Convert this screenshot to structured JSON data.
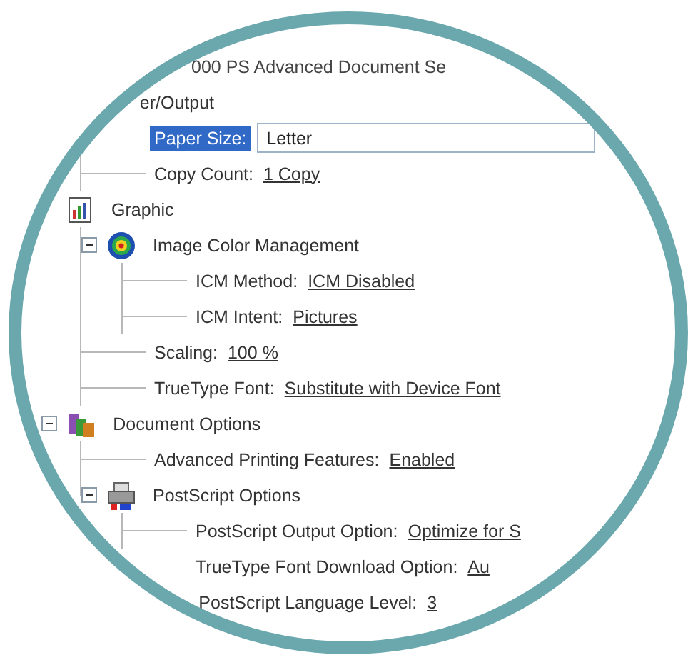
{
  "title": "000 PS Advanced Document Se",
  "tree": [
    {
      "kind": "section",
      "label": "er/Output",
      "children": [
        {
          "kind": "dropdown",
          "label": "Paper Size:",
          "value": "Letter",
          "selected": true
        },
        {
          "kind": "setting",
          "label": "Copy Count:",
          "value": "1 Copy",
          "selected": false
        }
      ]
    },
    {
      "kind": "graphic",
      "label": "Graphic",
      "children": [
        {
          "kind": "color-management",
          "label": "Image Color Management",
          "expanded": true,
          "children": [
            {
              "kind": "setting",
              "label": "ICM Method:",
              "value": "ICM Disabled",
              "selected": false
            },
            {
              "kind": "setting",
              "label": "ICM Intent:",
              "value": "Pictures",
              "selected": false
            }
          ]
        },
        {
          "kind": "setting",
          "label": "Scaling:",
          "value": "100 %",
          "selected": false
        },
        {
          "kind": "setting",
          "label": "TrueType Font:",
          "value": "Substitute with Device Font",
          "selected": false
        }
      ]
    },
    {
      "kind": "document-options",
      "label": "Document Options",
      "expanded": true,
      "children": [
        {
          "kind": "setting",
          "label": "Advanced Printing Features:",
          "value": "Enabled",
          "selected": false
        },
        {
          "kind": "postscript",
          "label": "PostScript Options",
          "expanded": true,
          "children": [
            {
              "kind": "setting",
              "label": "PostScript Output Option:",
              "value": "Optimize for S",
              "selected": false
            },
            {
              "kind": "setting",
              "label": "TrueType Font Download Option:",
              "value": "Au",
              "selected": false
            },
            {
              "kind": "setting",
              "label": "PostScript Language Level:",
              "value": "3",
              "selected": false
            }
          ]
        }
      ]
    }
  ]
}
